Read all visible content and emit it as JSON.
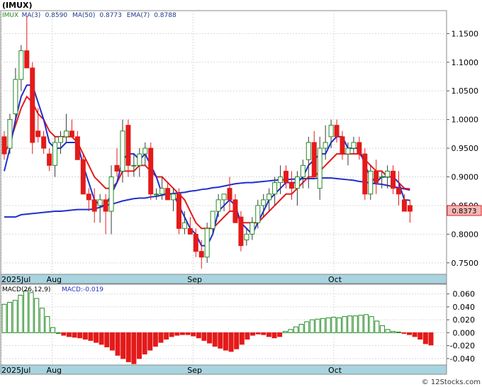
{
  "header": {
    "symbol": "(IMUX)",
    "legend": [
      {
        "label": "IMUX",
        "color": "#228B22"
      },
      {
        "label": "MA(3)",
        "color": "#1E3A8A"
      },
      {
        "label": "0.8590",
        "color": "#1E3A8A"
      },
      {
        "label": "MA(50)",
        "color": "#1E3A8A"
      },
      {
        "label": "0.8773",
        "color": "#1E3A8A"
      },
      {
        "label": "EMA(7)",
        "color": "#1E3A8A"
      },
      {
        "label": "0.8788",
        "color": "#1E3A8A"
      }
    ]
  },
  "price_badge": "0.8373",
  "macd_legend": {
    "label": "MACD(26,12,9)",
    "value": "MACD:-0.019"
  },
  "months": [
    {
      "label": "2025Jul",
      "index": 0
    },
    {
      "label": "Aug",
      "index": 9
    },
    {
      "label": "Sep",
      "index": 34
    },
    {
      "label": "Oct",
      "index": 59
    }
  ],
  "watermark": "© 12Stocks.com",
  "colors": {
    "up": "#228B22",
    "down": "#E41A1A",
    "ma": "#1F2FCC",
    "ema": "#E41A1A",
    "axis_band": "#A8D4E0"
  },
  "chart_data": [
    {
      "type": "candlestick",
      "title": "(IMUX)",
      "ylim": [
        0.73,
        1.19
      ],
      "yticks": [
        1.15,
        1.1,
        1.05,
        1.0,
        0.95,
        0.9,
        0.85,
        0.8,
        0.75
      ],
      "ytick_labels": [
        "1.1500",
        "1.1000",
        "1.0500",
        "1.0000",
        "0.9500",
        "0.9000",
        "0.8500",
        "0.8000",
        "0.7500"
      ],
      "ohlc": [
        [
          0.97,
          0.98,
          0.93,
          0.94
        ],
        [
          0.95,
          1.01,
          0.94,
          1.0
        ],
        [
          1.01,
          1.09,
          1.0,
          1.07
        ],
        [
          1.07,
          1.13,
          1.05,
          1.12
        ],
        [
          1.12,
          1.18,
          1.1,
          1.09
        ],
        [
          1.09,
          1.1,
          0.94,
          0.96
        ],
        [
          0.98,
          1.02,
          0.96,
          0.97
        ],
        [
          0.97,
          0.98,
          0.94,
          0.95
        ],
        [
          0.94,
          0.95,
          0.91,
          0.92
        ],
        [
          0.92,
          0.97,
          0.9,
          0.96
        ],
        [
          0.96,
          0.98,
          0.94,
          0.97
        ],
        [
          0.97,
          1.01,
          0.96,
          0.98
        ],
        [
          0.98,
          1.0,
          0.97,
          0.97
        ],
        [
          0.97,
          0.98,
          0.93,
          0.93
        ],
        [
          0.93,
          0.94,
          0.87,
          0.87
        ],
        [
          0.87,
          0.88,
          0.84,
          0.86
        ],
        [
          0.86,
          0.88,
          0.82,
          0.84
        ],
        [
          0.85,
          0.87,
          0.82,
          0.86
        ],
        [
          0.86,
          0.87,
          0.8,
          0.84
        ],
        [
          0.84,
          0.92,
          0.8,
          0.9
        ],
        [
          0.92,
          0.95,
          0.9,
          0.91
        ],
        [
          0.91,
          1.0,
          0.89,
          0.98
        ],
        [
          0.99,
          1.0,
          0.9,
          0.92
        ],
        [
          0.92,
          0.94,
          0.9,
          0.92
        ],
        [
          0.92,
          0.95,
          0.9,
          0.94
        ],
        [
          0.94,
          0.96,
          0.92,
          0.95
        ],
        [
          0.95,
          0.96,
          0.86,
          0.87
        ],
        [
          0.87,
          0.88,
          0.86,
          0.87
        ],
        [
          0.87,
          0.9,
          0.86,
          0.88
        ],
        [
          0.88,
          0.89,
          0.86,
          0.86
        ],
        [
          0.86,
          0.88,
          0.84,
          0.87
        ],
        [
          0.87,
          0.88,
          0.8,
          0.81
        ],
        [
          0.81,
          0.84,
          0.8,
          0.82
        ],
        [
          0.81,
          0.83,
          0.8,
          0.8
        ],
        [
          0.8,
          0.81,
          0.76,
          0.77
        ],
        [
          0.77,
          0.79,
          0.74,
          0.76
        ],
        [
          0.76,
          0.82,
          0.75,
          0.81
        ],
        [
          0.81,
          0.84,
          0.8,
          0.84
        ],
        [
          0.84,
          0.87,
          0.83,
          0.86
        ],
        [
          0.86,
          0.87,
          0.84,
          0.87
        ],
        [
          0.88,
          0.9,
          0.84,
          0.86
        ],
        [
          0.86,
          0.87,
          0.82,
          0.82
        ],
        [
          0.83,
          0.84,
          0.77,
          0.78
        ],
        [
          0.79,
          0.81,
          0.78,
          0.8
        ],
        [
          0.8,
          0.83,
          0.79,
          0.82
        ],
        [
          0.82,
          0.86,
          0.81,
          0.85
        ],
        [
          0.85,
          0.87,
          0.83,
          0.86
        ],
        [
          0.86,
          0.88,
          0.84,
          0.87
        ],
        [
          0.87,
          0.9,
          0.85,
          0.89
        ],
        [
          0.89,
          0.92,
          0.87,
          0.9
        ],
        [
          0.91,
          0.92,
          0.88,
          0.89
        ],
        [
          0.89,
          0.91,
          0.86,
          0.88
        ],
        [
          0.88,
          0.91,
          0.85,
          0.9
        ],
        [
          0.9,
          0.93,
          0.88,
          0.92
        ],
        [
          0.93,
          0.97,
          0.88,
          0.96
        ],
        [
          0.96,
          0.98,
          0.9,
          0.9
        ],
        [
          0.88,
          0.97,
          0.86,
          0.95
        ],
        [
          0.95,
          0.99,
          0.93,
          0.96
        ],
        [
          0.97,
          1.0,
          0.95,
          0.99
        ],
        [
          0.99,
          1.0,
          0.96,
          0.97
        ],
        [
          0.97,
          0.98,
          0.93,
          0.94
        ],
        [
          0.94,
          0.96,
          0.92,
          0.95
        ],
        [
          0.95,
          0.97,
          0.94,
          0.96
        ],
        [
          0.96,
          0.97,
          0.93,
          0.94
        ],
        [
          0.94,
          0.95,
          0.86,
          0.87
        ],
        [
          0.87,
          0.92,
          0.86,
          0.91
        ],
        [
          0.91,
          0.93,
          0.87,
          0.89
        ],
        [
          0.9,
          0.91,
          0.88,
          0.9
        ],
        [
          0.9,
          0.92,
          0.88,
          0.91
        ],
        [
          0.91,
          0.92,
          0.87,
          0.88
        ],
        [
          0.88,
          0.91,
          0.85,
          0.87
        ],
        [
          0.86,
          0.87,
          0.84,
          0.84
        ],
        [
          0.85,
          0.86,
          0.82,
          0.84
        ]
      ],
      "ma3": [
        0.91,
        0.95,
        1.0,
        1.04,
        1.06,
        1.06,
        1.03,
        1.0,
        0.96,
        0.95,
        0.95,
        0.96,
        0.96,
        0.96,
        0.92,
        0.89,
        0.86,
        0.85,
        0.85,
        0.87,
        0.89,
        0.93,
        0.94,
        0.94,
        0.93,
        0.94,
        0.92,
        0.9,
        0.87,
        0.87,
        0.87,
        0.85,
        0.83,
        0.81,
        0.8,
        0.78,
        0.78,
        0.8,
        0.84,
        0.85,
        0.86,
        0.85,
        0.82,
        0.81,
        0.8,
        0.82,
        0.84,
        0.86,
        0.87,
        0.88,
        0.89,
        0.89,
        0.89,
        0.9,
        0.92,
        0.93,
        0.94,
        0.94,
        0.96,
        0.97,
        0.97,
        0.95,
        0.95,
        0.95,
        0.92,
        0.9,
        0.89,
        0.9,
        0.9,
        0.9,
        0.89,
        0.86,
        0.859
      ],
      "ma50": [
        0.83,
        0.83,
        0.83,
        0.834,
        0.835,
        0.836,
        0.837,
        0.838,
        0.839,
        0.84,
        0.84,
        0.841,
        0.842,
        0.843,
        0.843,
        0.843,
        0.844,
        0.847,
        0.85,
        0.852,
        0.855,
        0.858,
        0.86,
        0.862,
        0.863,
        0.863,
        0.865,
        0.866,
        0.868,
        0.87,
        0.871,
        0.872,
        0.873,
        0.875,
        0.876,
        0.878,
        0.879,
        0.881,
        0.882,
        0.884,
        0.886,
        0.888,
        0.889,
        0.89,
        0.89,
        0.891,
        0.892,
        0.893,
        0.894,
        0.895,
        0.895,
        0.896,
        0.896,
        0.897,
        0.897,
        0.897,
        0.898,
        0.898,
        0.898,
        0.897,
        0.896,
        0.895,
        0.894,
        0.892,
        0.891,
        0.889,
        0.888,
        0.887,
        0.885,
        0.883,
        0.881,
        0.879,
        0.877
      ],
      "ema7": [
        0.94,
        0.96,
        0.99,
        1.02,
        1.04,
        1.03,
        1.01,
        1.0,
        0.98,
        0.97,
        0.97,
        0.97,
        0.97,
        0.96,
        0.94,
        0.92,
        0.9,
        0.89,
        0.88,
        0.88,
        0.89,
        0.91,
        0.91,
        0.91,
        0.92,
        0.92,
        0.91,
        0.9,
        0.9,
        0.89,
        0.88,
        0.87,
        0.86,
        0.84,
        0.82,
        0.81,
        0.81,
        0.81,
        0.82,
        0.83,
        0.84,
        0.84,
        0.82,
        0.82,
        0.82,
        0.82,
        0.83,
        0.84,
        0.85,
        0.86,
        0.87,
        0.87,
        0.88,
        0.89,
        0.9,
        0.9,
        0.91,
        0.92,
        0.93,
        0.94,
        0.94,
        0.94,
        0.94,
        0.94,
        0.93,
        0.92,
        0.91,
        0.91,
        0.9,
        0.9,
        0.89,
        0.88,
        0.879
      ]
    },
    {
      "type": "bar",
      "title": "MACD(26,12,9)",
      "ylim": [
        -0.05,
        0.075
      ],
      "yticks": [
        0.06,
        0.04,
        0.02,
        0.0,
        -0.02,
        -0.04
      ],
      "ytick_labels": [
        "0.060",
        "0.040",
        "0.020",
        "0.000",
        "-0.020",
        "-0.040"
      ],
      "values": [
        0.044,
        0.047,
        0.05,
        0.058,
        0.065,
        0.062,
        0.053,
        0.038,
        0.025,
        0.008,
        0.0,
        -0.004,
        -0.006,
        -0.007,
        -0.008,
        -0.01,
        -0.012,
        -0.015,
        -0.018,
        -0.022,
        -0.027,
        -0.035,
        -0.04,
        -0.045,
        -0.048,
        -0.04,
        -0.033,
        -0.027,
        -0.021,
        -0.015,
        -0.01,
        -0.006,
        -0.004,
        -0.003,
        -0.003,
        -0.005,
        -0.008,
        -0.012,
        -0.016,
        -0.021,
        -0.024,
        -0.027,
        -0.029,
        -0.025,
        -0.018,
        -0.01,
        -0.004,
        -0.002,
        -0.003,
        -0.006,
        -0.008,
        -0.006,
        0.002,
        0.005,
        0.009,
        0.013,
        0.017,
        0.02,
        0.021,
        0.022,
        0.023,
        0.024,
        0.023,
        0.025,
        0.026,
        0.026,
        0.027,
        0.028,
        0.025,
        0.018,
        0.011,
        0.005,
        0.002,
        0.001,
        -0.001,
        -0.003,
        -0.006,
        -0.01,
        -0.017,
        -0.019
      ]
    }
  ]
}
